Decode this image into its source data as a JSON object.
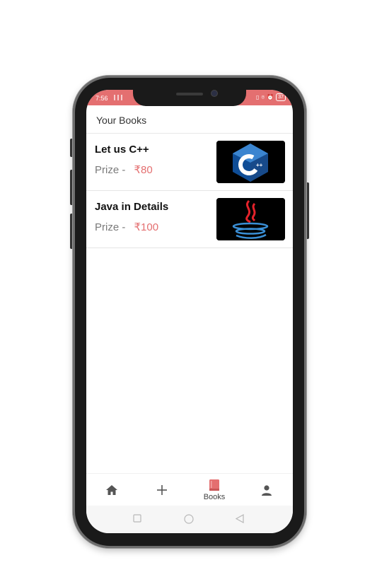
{
  "status_bar": {
    "time": "7:56",
    "signal": "∥∥∥",
    "battery": "37"
  },
  "header": {
    "title": "Your Books"
  },
  "books": [
    {
      "title": "Let us C++",
      "price_label": "Prize -",
      "price": "₹80",
      "cover_icon": "cpp-logo-icon"
    },
    {
      "title": "Java in Details",
      "price_label": "Prize -",
      "price": "₹100",
      "cover_icon": "java-logo-icon"
    }
  ],
  "bottom_nav": {
    "items": [
      {
        "icon": "home-icon",
        "label": ""
      },
      {
        "icon": "plus-icon",
        "label": ""
      },
      {
        "icon": "book-icon",
        "label": "Books",
        "active": true
      },
      {
        "icon": "person-icon",
        "label": ""
      }
    ]
  },
  "colors": {
    "accent": "#e46f70",
    "price_label": "#7a7a7a",
    "title": "#111111"
  }
}
